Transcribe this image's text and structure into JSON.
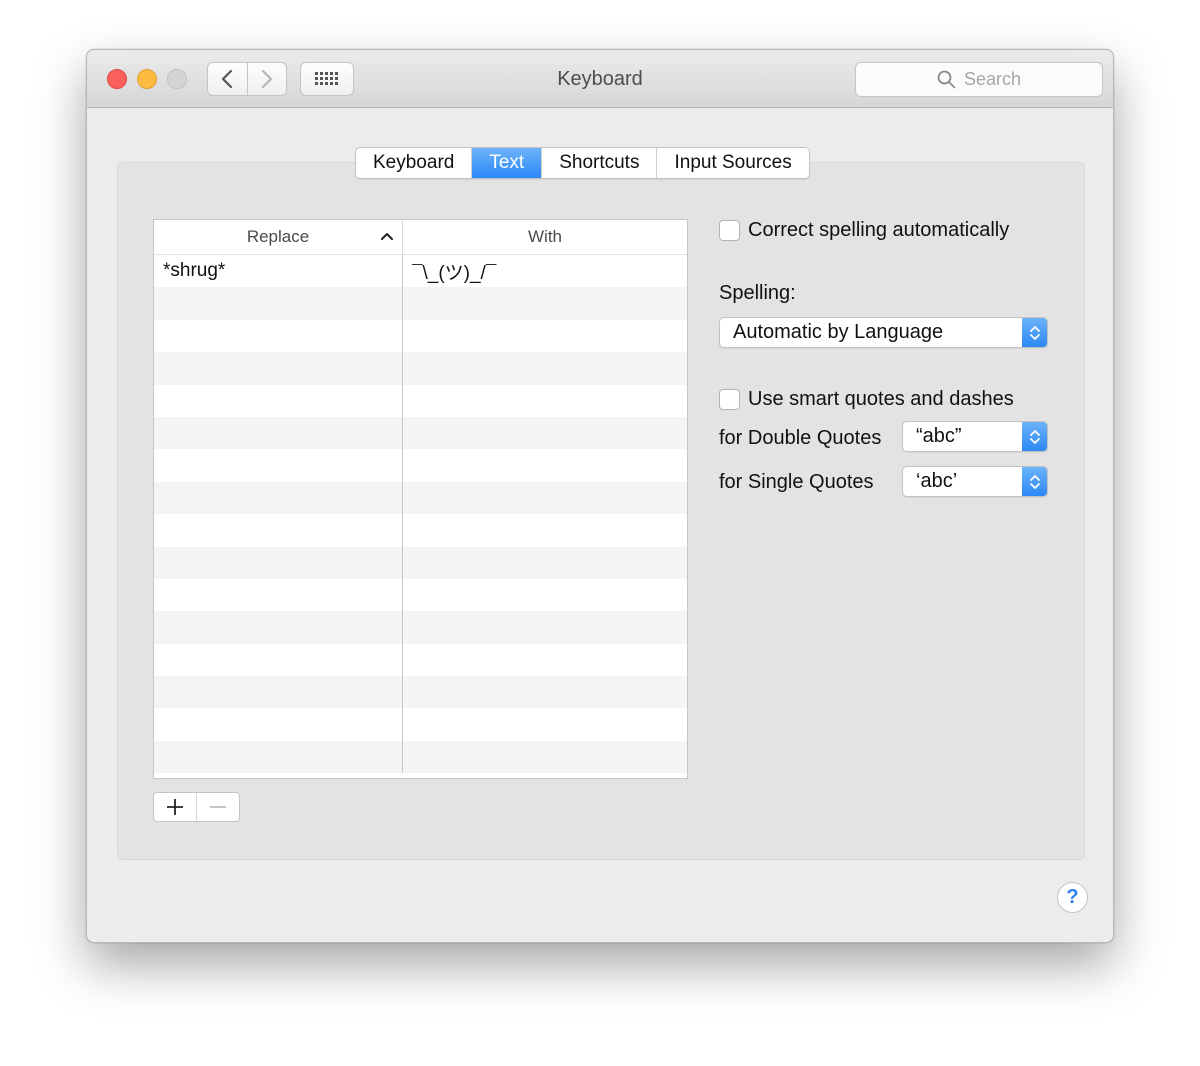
{
  "window": {
    "title": "Keyboard",
    "search_placeholder": "Search"
  },
  "tabs": [
    {
      "label": "Keyboard",
      "active": false
    },
    {
      "label": "Text",
      "active": true
    },
    {
      "label": "Shortcuts",
      "active": false
    },
    {
      "label": "Input Sources",
      "active": false
    }
  ],
  "table": {
    "headers": {
      "replace": "Replace",
      "with": "With"
    },
    "sort": "ascending",
    "rows": [
      {
        "replace": "*shrug*",
        "with": "¯\\_(ツ)_/¯"
      }
    ],
    "empty_rows": 15
  },
  "options": {
    "correct_spelling_label": "Correct spelling automatically",
    "correct_spelling_checked": false,
    "spelling_label": "Spelling:",
    "spelling_value": "Automatic by Language",
    "smart_quotes_label": "Use smart quotes and dashes",
    "smart_quotes_checked": false,
    "double_quotes_label": "for Double Quotes",
    "double_quotes_value": "“abc”",
    "single_quotes_label": "for Single Quotes",
    "single_quotes_value": "‘abc’"
  },
  "icons": {
    "back": "chevron-left-icon",
    "forward": "chevron-right-icon",
    "grid": "grid-icon",
    "search": "search-icon",
    "add": "plus-icon",
    "remove": "minus-icon",
    "help": "?"
  },
  "colors": {
    "accent": "#2b88f6",
    "close": "#fc605c",
    "minimize": "#fdbc40"
  }
}
